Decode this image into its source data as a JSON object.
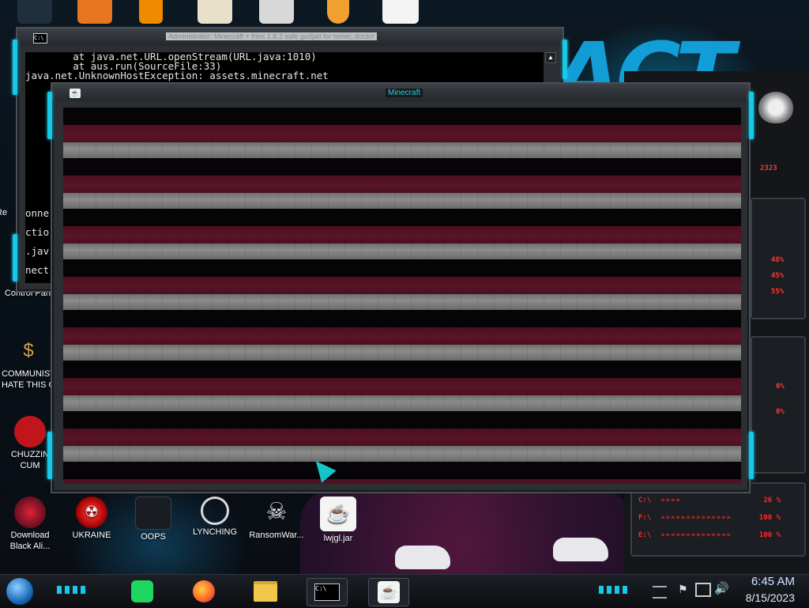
{
  "console_window": {
    "title": "Administrator:  Minecraft + fries 1.8.2 safe gudjati for tomei, doctor",
    "icon_label": "C:\\",
    "lines": [
      "        at java.net.URL.openStream(URL.java:1010)",
      "        at aus.run(SourceFile:33)",
      "java.net.UnknownHostException: assets.minecraft.net"
    ],
    "side_fragments": [
      "onne",
      "ctio",
      ".jav",
      "nect"
    ]
  },
  "minecraft_window": {
    "title": "Minecraft",
    "icon": "java-icon"
  },
  "desktop_icons": [
    {
      "label": "Control Pane",
      "icon": "control-panel-icon"
    },
    {
      "label": "COMMUNIST\nHATE THIS G",
      "icon": "money-bag-icon"
    },
    {
      "label": "CHUZZIN\nCUM",
      "icon": "red-chuzzle-icon"
    },
    {
      "label": "Download\nBlack Ali...",
      "icon": "alienware-orb-icon"
    },
    {
      "label": "UKRAINE",
      "icon": "radiation-icon"
    },
    {
      "label": "OOPS",
      "icon": "computer-virus-icon"
    },
    {
      "label": "LYNCHING",
      "icon": "noose-icon"
    },
    {
      "label": "RansomWar...",
      "icon": "skull-icon"
    },
    {
      "label": "lwjgl.jar",
      "icon": "java-jar-icon"
    }
  ],
  "left_partial_label": "Re",
  "gadget": {
    "clock_readout": "2323",
    "cpu_values": [
      "48%",
      "45%",
      "55%"
    ],
    "mid_values": [
      "0%",
      "0%"
    ],
    "drives": [
      {
        "label": "C:\\",
        "value": "26 %"
      },
      {
        "label": "F:\\",
        "value": "100 %"
      },
      {
        "label": "E:\\",
        "value": "100 %"
      }
    ]
  },
  "taskbar": {
    "apps": [
      "spotify-icon",
      "firefox-icon",
      "file-explorer-icon",
      "command-prompt-icon",
      "java-icon"
    ],
    "cmd_label": "C:\\",
    "time": "6:45 AM",
    "date": "8/15/2023"
  },
  "colors": {
    "accent": "#17c9e6",
    "gadget_red": "#ff3838",
    "game_maroon": "#5a1528",
    "game_gray": "#8c8c8c"
  }
}
